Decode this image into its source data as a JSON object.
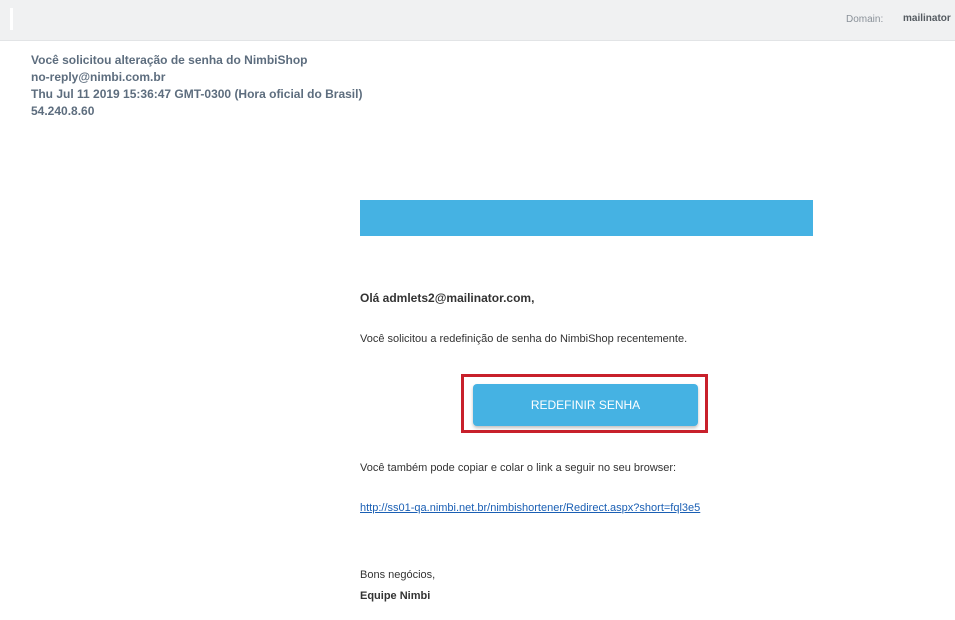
{
  "topbar": {
    "domain_label": "Domain:",
    "domain_value": "mailinator"
  },
  "message_header": {
    "subject": "Você solicitou alteração de senha do NimbiShop",
    "from": "no-reply@nimbi.com.br",
    "date": "Thu Jul 11 2019 15:36:47 GMT-0300 (Hora oficial do Brasil)",
    "ip": "54.240.8.60"
  },
  "email_body": {
    "greeting": "Olá admlets2@mailinator.com,",
    "paragraph1": "Você solicitou a redefinição de senha do NimbiShop recentemente.",
    "button_label": "REDEFINIR SENHA",
    "paragraph2": "Você também pode copiar e colar o link a seguir no seu browser:",
    "link_text": "http://ss01-qa.nimbi.net.br/nimbishortener/Redirect.aspx?short=fql3e5",
    "signoff": "Bons negócios,",
    "team": "Equipe Nimbi"
  },
  "colors": {
    "banner": "#45b2e3",
    "button": "#45b2e3",
    "highlight_outline": "#c8202b",
    "header_text": "#5d6d7e",
    "link": "#1a5fb4"
  }
}
